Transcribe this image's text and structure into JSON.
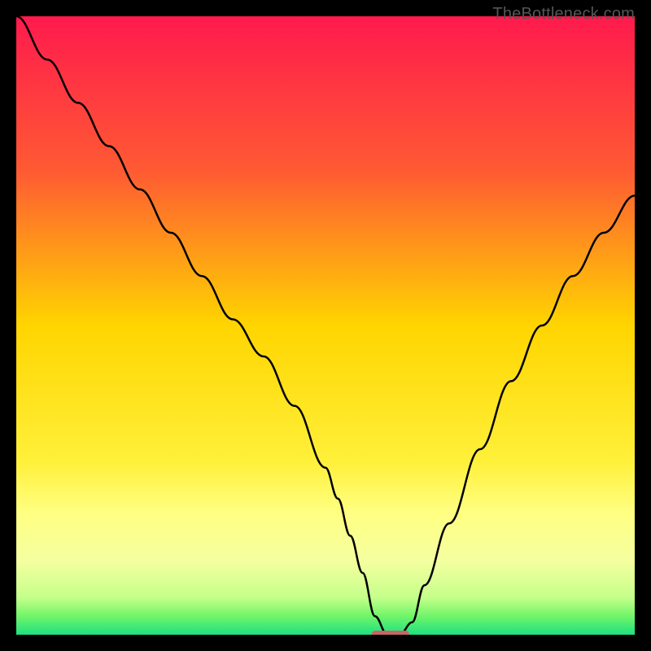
{
  "watermark": "TheBottleneck.com",
  "chart_data": {
    "type": "line",
    "title": "",
    "xlabel": "",
    "ylabel": "",
    "xlim": [
      0,
      100
    ],
    "ylim": [
      0,
      100
    ],
    "grid": false,
    "background_gradient": {
      "stops": [
        {
          "offset": 0.0,
          "color": "#ff1a4d"
        },
        {
          "offset": 0.25,
          "color": "#ff5a33"
        },
        {
          "offset": 0.5,
          "color": "#ffd500"
        },
        {
          "offset": 0.72,
          "color": "#fff03a"
        },
        {
          "offset": 0.8,
          "color": "#ffff80"
        },
        {
          "offset": 0.88,
          "color": "#f5ffa0"
        },
        {
          "offset": 0.94,
          "color": "#c5ff8a"
        },
        {
          "offset": 0.97,
          "color": "#70f56a"
        },
        {
          "offset": 1.0,
          "color": "#1de080"
        }
      ]
    },
    "series": [
      {
        "name": "bottleneck-curve",
        "x": [
          0,
          5,
          10,
          15,
          20,
          25,
          30,
          35,
          40,
          45,
          50,
          52,
          54,
          56,
          58,
          60,
          62,
          64,
          66,
          70,
          75,
          80,
          85,
          90,
          95,
          100
        ],
        "y": [
          100,
          93,
          86,
          79,
          72,
          65,
          58,
          51,
          45,
          37,
          27,
          22,
          16,
          10,
          3,
          0,
          0,
          2,
          8,
          18,
          30,
          41,
          50,
          58,
          65,
          71
        ]
      }
    ],
    "marker": {
      "name": "optimal-marker",
      "x": 60.5,
      "y": 0,
      "width": 6,
      "color": "#c86464"
    }
  }
}
